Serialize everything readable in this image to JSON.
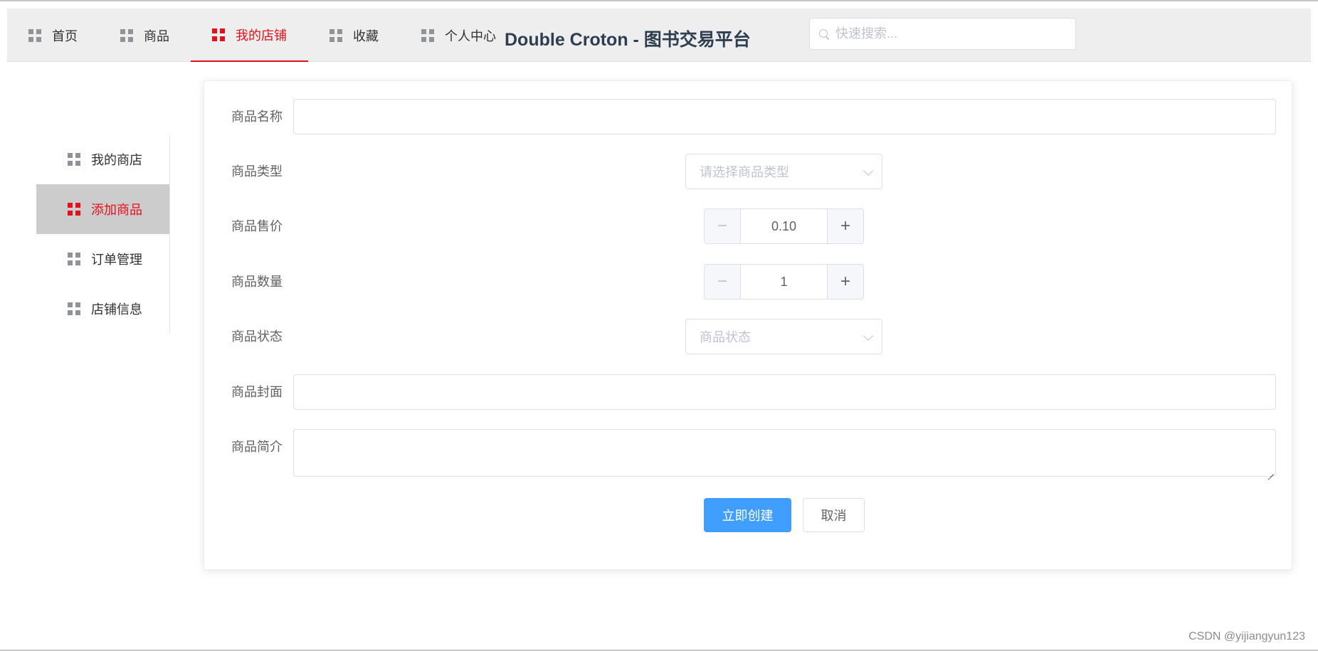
{
  "header": {
    "nav": [
      {
        "label": "首页",
        "icon": "grid-icon"
      },
      {
        "label": "商品",
        "icon": "grid-icon"
      },
      {
        "label": "我的店铺",
        "icon": "grid-icon",
        "active": true
      },
      {
        "label": "收藏",
        "icon": "grid-icon"
      },
      {
        "label": "个人中心",
        "icon": "grid-icon"
      }
    ],
    "brand": "Double Croton - 图书交易平台",
    "search_placeholder": "快速搜索..."
  },
  "sidebar": {
    "items": [
      {
        "label": "我的商店",
        "icon": "grid-icon"
      },
      {
        "label": "添加商品",
        "icon": "grid-icon",
        "active": true
      },
      {
        "label": "订单管理",
        "icon": "grid-icon"
      },
      {
        "label": "店铺信息",
        "icon": "grid-icon"
      }
    ]
  },
  "form": {
    "name_label": "商品名称",
    "name_value": "",
    "type_label": "商品类型",
    "type_placeholder": "请选择商品类型",
    "price_label": "商品售价",
    "price_value": "0.10",
    "quantity_label": "商品数量",
    "quantity_value": "1",
    "status_label": "商品状态",
    "status_placeholder": "商品状态",
    "cover_label": "商品封面",
    "cover_value": "",
    "intro_label": "商品简介",
    "intro_value": "",
    "submit_label": "立即创建",
    "cancel_label": "取消",
    "minus_symbol": "−",
    "plus_symbol": "+"
  },
  "watermark": "CSDN @yijiangyun123",
  "colors": {
    "active": "#e4101b",
    "primary": "#409eff",
    "header_bg": "#eeeeee",
    "sidebar_active_bg": "#cccccc"
  }
}
